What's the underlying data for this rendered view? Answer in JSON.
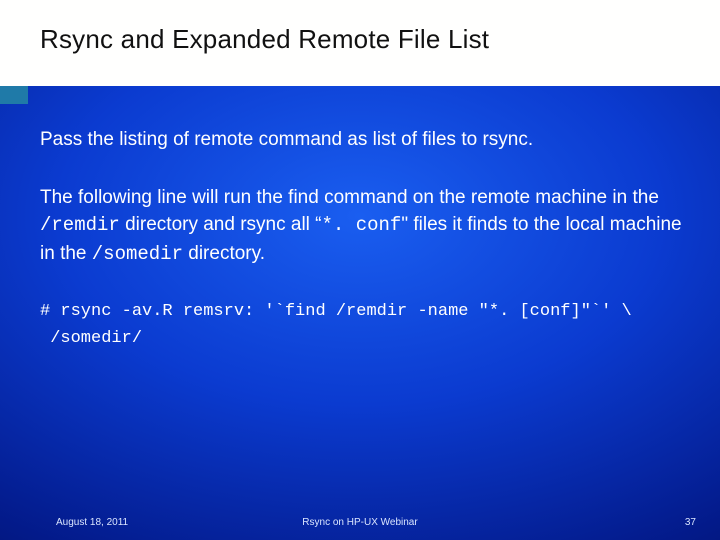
{
  "slide": {
    "title": "Rsync and Expanded Remote File List",
    "intro": "Pass the listing of remote command as list of files to rsync.",
    "desc_pre": "The following line will run the find command on the remote machine in the ",
    "desc_dir1": "/remdir",
    "desc_mid1": " directory and rsync all “",
    "desc_pat": "*. conf",
    "desc_mid2": "\" files it finds to the local machine in the ",
    "desc_dir2": "/somedir",
    "desc_end": " directory.",
    "cmd_line1": "# rsync -av.R remsrv: '`find /remdir -name \"*. [conf]\"`' \\",
    "cmd_line2": " /somedir/"
  },
  "footer": {
    "date": "August 18, 2011",
    "title": "Rsync on HP-UX Webinar",
    "page": "37"
  }
}
